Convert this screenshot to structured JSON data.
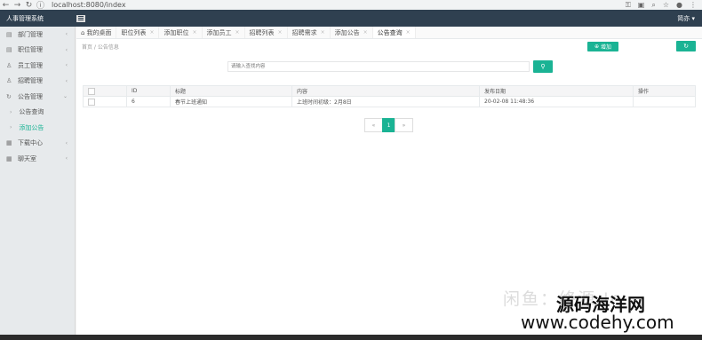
{
  "browser": {
    "url": "localhost:8080/index"
  },
  "app": {
    "title": "人事管理系统",
    "user": "简亦 ▾"
  },
  "sidebar": {
    "items": [
      {
        "label": "部门管理"
      },
      {
        "label": "职位管理"
      },
      {
        "label": "员工管理"
      },
      {
        "label": "招聘管理"
      },
      {
        "label": "公告管理"
      }
    ],
    "subitems": [
      {
        "label": "公告查询"
      },
      {
        "label": "添加公告"
      }
    ],
    "items2": [
      {
        "label": "下载中心"
      },
      {
        "label": "聊天室"
      }
    ]
  },
  "tabs": [
    {
      "label": "我的桌面"
    },
    {
      "label": "职位列表"
    },
    {
      "label": "添加职位"
    },
    {
      "label": "添加员工"
    },
    {
      "label": "招聘列表"
    },
    {
      "label": "招聘需求"
    },
    {
      "label": "添加公告"
    },
    {
      "label": "公告查询"
    }
  ],
  "breadcrumb": "首页 / 公告信息",
  "toolbar": {
    "add_label": "增加"
  },
  "search": {
    "placeholder": "请输入查找内容"
  },
  "table": {
    "headers": [
      "",
      "ID",
      "标题",
      "内容",
      "发布日期",
      "操作"
    ],
    "rows": [
      [
        "",
        "6",
        "春节上班通知",
        "上班时间初级：2月8日",
        "20-02-08 11:48:36",
        ""
      ]
    ]
  },
  "pager": {
    "prev": "«",
    "current": "1",
    "next": "»"
  },
  "watermark": {
    "faint": "闲鱼：终源 Ir",
    "site": "源码海洋网",
    "url": "www.codehy.com"
  }
}
